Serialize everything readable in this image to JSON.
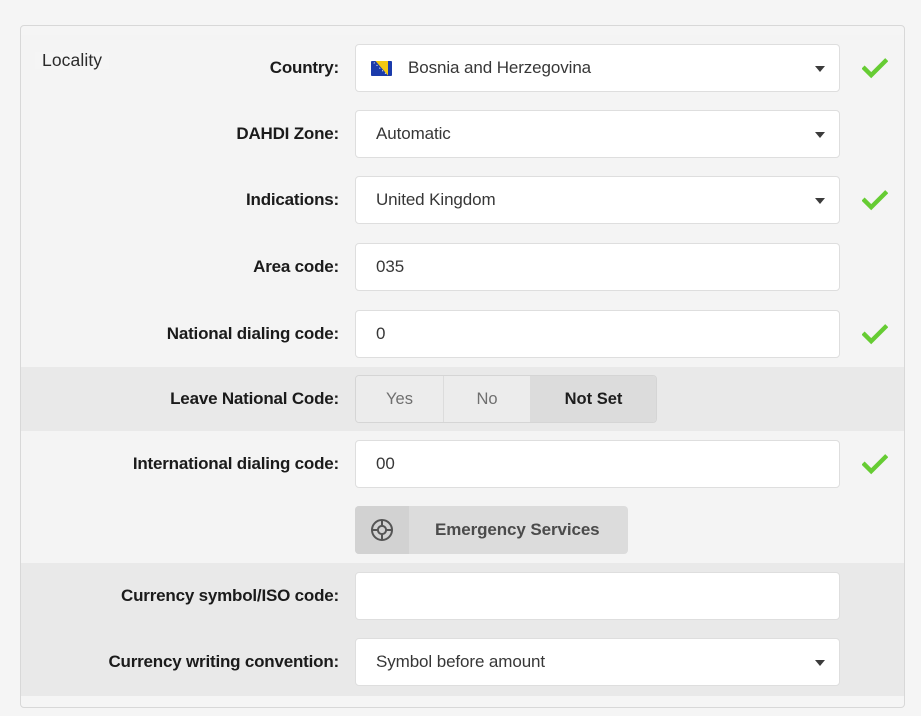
{
  "fieldset": {
    "legend": "Locality"
  },
  "rows": [
    {
      "label": "Country:",
      "type": "select",
      "value": "Bosnia and Herzegovina",
      "icon": "flag-bosnia-and-herzegovina",
      "valid": true
    },
    {
      "label": "DAHDI Zone:",
      "type": "select",
      "value": "Automatic",
      "valid": false
    },
    {
      "label": "Indications:",
      "type": "select",
      "value": "United Kingdom",
      "valid": true
    },
    {
      "label": "Area code:",
      "type": "text",
      "value": "035",
      "valid": false
    },
    {
      "label": "National dialing code:",
      "type": "text",
      "value": "0",
      "valid": true
    },
    {
      "label": "Leave National Code:",
      "type": "segmented",
      "options": [
        "Yes",
        "No",
        "Not Set"
      ],
      "selected": "Not Set",
      "valid": false
    },
    {
      "label": "International dialing code:",
      "type": "text",
      "value": "00",
      "valid": true
    },
    {
      "label": "",
      "type": "icon-button",
      "button_label": "Emergency Services",
      "icon": "lifebuoy-icon",
      "valid": false
    },
    {
      "label": "Currency symbol/ISO code:",
      "type": "text",
      "value": "",
      "placeholder": "",
      "valid": false
    },
    {
      "label": "Currency writing convention:",
      "type": "select",
      "value": "Symbol before amount",
      "valid": false
    }
  ],
  "colors": {
    "check_green": "#66cc33",
    "row_light": "#f4f4f4",
    "row_dark": "#e9e9e9",
    "page_bg": "#f5f5f5",
    "flag_blue": "#1b3bab",
    "flag_yellow": "#f2c811"
  }
}
